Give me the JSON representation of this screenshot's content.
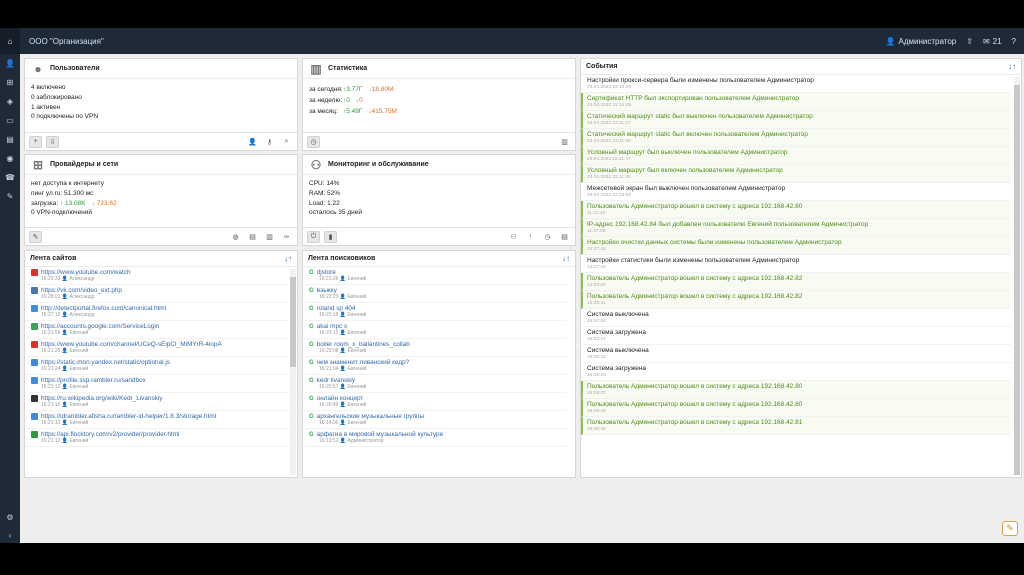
{
  "topbar": {
    "org": "ООО \"Организация\"",
    "user": "Администратор",
    "notifications": "21"
  },
  "users": {
    "title": "Пользователи",
    "lines": [
      "4 включено",
      "0 заблокировано",
      "1 активен",
      "0 подключены по VPN"
    ]
  },
  "stats": {
    "title": "Статистика",
    "rows": [
      {
        "label": "за сегодня:",
        "up": "↑3.77Г",
        "down": "↓18.80М"
      },
      {
        "label": "за неделю:",
        "up": "↑0",
        "down": "↓0"
      },
      {
        "label": "за месяц:",
        "up": "↑5.49Г",
        "down": "↓415.75М"
      }
    ]
  },
  "providers": {
    "title": "Провайдеры и сети",
    "lines": [
      "нет доступа к интернету",
      "пинг ул.ru: 51.300 мс"
    ],
    "load_label": "загрузка:",
    "load_up": "↑ 13.08K",
    "load_down": "↓ 733.62",
    "vpn": "0 VPN-подключений"
  },
  "monitoring": {
    "title": "Мониторинг и обслуживание",
    "lines": [
      "CPU: 14%",
      "RAM: 52%",
      "Load: 1.22",
      "осталось 35 дней"
    ]
  },
  "sites": {
    "title": "Лента сайтов",
    "items": [
      {
        "url": "https://www.youtube.com/watch",
        "time": "16:29:39",
        "user": "Александр",
        "color": "#e52d27"
      },
      {
        "url": "https://vk.com/video_ext.php",
        "time": "16:28:01",
        "user": "Александр",
        "color": "#4a76a8"
      },
      {
        "url": "http://detectportal.firefox.com/canonical.html",
        "time": "16:27:19",
        "user": "Александр",
        "color": "#3b8de0"
      },
      {
        "url": "https://accounts.google.com/ServiceLogin",
        "time": "16:21:59",
        "user": "Евгений",
        "color": "#34a853"
      },
      {
        "url": "https://www.youtube.com/channel/UCeQ-sEipCI_MiMYrR-4iopA",
        "time": "16:21:25",
        "user": "Евгений",
        "color": "#e52d27"
      },
      {
        "url": "https://static-mon.yandex.net/static/optional.js",
        "time": "16:21:24",
        "user": "Евгений",
        "color": "#3b8de0"
      },
      {
        "url": "https://profile.ssp.rambler.ru/sandbox",
        "time": "16:21:13",
        "user": "Евгений",
        "color": "#3b8de0"
      },
      {
        "url": "https://ru.wikipedia.org/wiki/Kedr_Livanskiy",
        "time": "16:21:13",
        "user": "Евгений",
        "color": "#333333"
      },
      {
        "url": "https://idrambler.afisha.ru/rambler-id-helper/1.8.3/storage.html",
        "time": "16:21:13",
        "user": "Евгений",
        "color": "#3b8de0"
      },
      {
        "url": "https://api.flocktory.com/v2/provider/provider.html",
        "time": "16:21:12",
        "user": "Евгений",
        "color": "#2e9a3b"
      }
    ]
  },
  "search": {
    "title": "Лента поисковиков",
    "items": [
      {
        "q": "djstore",
        "time": "16:23:26",
        "user": "Евгений"
      },
      {
        "q": "вэыкку",
        "time": "16:23:23",
        "user": "Евгений"
      },
      {
        "q": "roland sp 404",
        "time": "16:23:18",
        "user": "Евгений"
      },
      {
        "q": "akai mpc x",
        "time": "16:23:13",
        "user": "Евгений"
      },
      {
        "q": "boiler room_x_ballantines_collab",
        "time": "16:23:08",
        "user": "Евгений"
      },
      {
        "q": "чем знаменит ливанский кедр?",
        "time": "16:21:04",
        "user": "Евгений"
      },
      {
        "q": "kedr livanskiy",
        "time": "16:20:57",
        "user": "Евгений"
      },
      {
        "q": "онлайн концерт",
        "time": "16:20:49",
        "user": "Евгений"
      },
      {
        "q": "архангельские музыкальные группы",
        "time": "16:14:00",
        "user": "Евгений"
      },
      {
        "q": "арфагиа в мировой музыкальной культуре",
        "time": "16:13:52",
        "user": "Администратор"
      }
    ]
  },
  "events": {
    "title": "События",
    "items": [
      {
        "text": "Настройки прокси-сервера были изменены пользователем Администратор",
        "time": "23.04.2022 22:16:29",
        "ok": false
      },
      {
        "text": "Сертификат HTTP был экспортирован пользователем Администратор",
        "time": "23.04.2022 22:16:49",
        "ok": true
      },
      {
        "text": "Статический маршрут static был выключен пользователем Администратор",
        "time": "23.04.2022 22:11:27",
        "ok": true
      },
      {
        "text": "Статический маршрут static был включен пользователем Администратор",
        "time": "23.04.2022 22:11:29",
        "ok": true
      },
      {
        "text": "Условный маршрут был выключен пользователем Администратор",
        "time": "23.04.2022 22:11:47",
        "ok": true
      },
      {
        "text": "Условный маршрут был включен пользователем Администратор",
        "time": "23.04.2022 22:11:48",
        "ok": true
      },
      {
        "text": "Межсетевой экран был выключен пользователем Администратор",
        "time": "23.04.2022 22:24:09",
        "ok": false
      },
      {
        "text": "Пользователь Администратор вошел в систему с адреса 192.168.42.80",
        "time": "11:41:42",
        "ok": true
      },
      {
        "text": "IP-адрес 192.168.42.84 был добавлен пользователю Евгений пользователем Администратор",
        "time": "11:47:08",
        "ok": true
      },
      {
        "text": "Настройки очистки данных системы были изменены пользователем Администратор",
        "time": "12:27:42",
        "ok": true
      },
      {
        "text": "Настройки статистики были изменены пользователем Администратор",
        "time": "12:27:42",
        "ok": false
      },
      {
        "text": "Пользователь Администратор вошел в систему с адреса 192.168.42.82",
        "time": "14:03:00",
        "ok": true
      },
      {
        "text": "Пользователь Администратор вошел в систему с адреса 192.168.42.82",
        "time": "15:25:41",
        "ok": true
      },
      {
        "text": "Система выключена",
        "time": "15:52:04",
        "ok": false
      },
      {
        "text": "Система загружена",
        "time": "15:53:27",
        "ok": false
      },
      {
        "text": "Система выключена",
        "time": "16:08:31",
        "ok": false
      },
      {
        "text": "Система загружена",
        "time": "16:09:20",
        "ok": false
      },
      {
        "text": "Пользователь Администратор вошел в систему с адреса 192.168.42.80",
        "time": "16:09:37",
        "ok": true
      },
      {
        "text": "Пользователь Администратор вошел в систему с адреса 192.168.42.80",
        "time": "16:09:44",
        "ok": true
      },
      {
        "text": "Пользователь Администратор вошел в систему с адреса 192.168.42.81",
        "time": "16:46:45",
        "ok": true
      }
    ]
  }
}
